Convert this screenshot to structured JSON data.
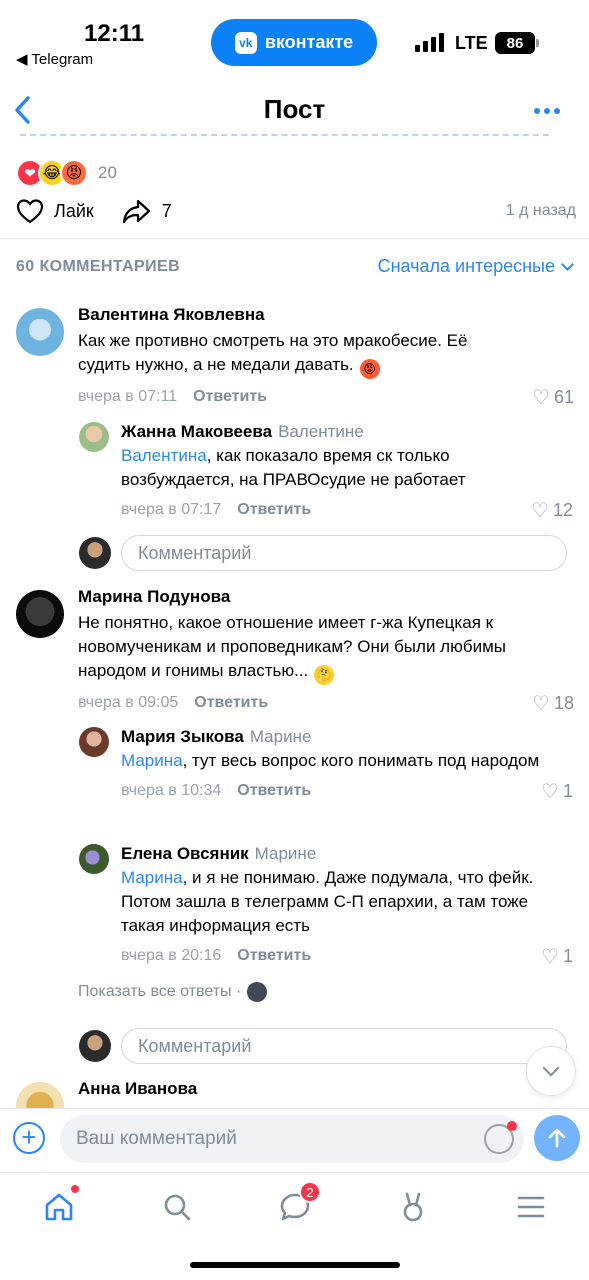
{
  "status_bar": {
    "time": "12:11",
    "back_app": "◀ Telegram",
    "pill_label": "вконтакте",
    "vk_logo": "vk",
    "network": "LTE",
    "battery": "86"
  },
  "nav": {
    "title": "Пост"
  },
  "post": {
    "reactions_count": "20",
    "like_label": "Лайк",
    "share_count": "7",
    "time": "1 д назад"
  },
  "comments_header": {
    "count_label": "60 КОММЕНТАРИЕВ",
    "sort_label": "Сначала интересные"
  },
  "comments": [
    {
      "name": "Валентина Яковлевна",
      "text": "Как же противно смотреть на это мракобесие. Её судить нужно, а не медали давать.",
      "time": "вчера в 07:11",
      "reply": "Ответить",
      "likes": "61",
      "replies": [
        {
          "name": "Жанна Маковеева",
          "to": "Валентине",
          "mention": "Валентина",
          "text": ", как показало время ск только возбуждается, на ПРАВОсудие не работает",
          "time": "вчера в 07:17",
          "reply": "Ответить",
          "likes": "12"
        }
      ]
    },
    {
      "name": "Марина Подунова",
      "text": "Не понятно, какое отношение имеет г-жа Купецкая к новомученикам и проповедникам? Они были любимы народом и гонимы властью...",
      "time": "вчера в 09:05",
      "reply": "Ответить",
      "likes": "18",
      "replies": [
        {
          "name": "Мария Зыкова",
          "to": "Марине",
          "mention": "Марина",
          "text": ", тут весь вопрос кого понимать под народом",
          "time": "вчера в 10:34",
          "reply": "Ответить",
          "likes": "1"
        },
        {
          "name": "Елена Овсяник",
          "to": "Марине",
          "mention": "Марина",
          "text": ",  и я не понимаю. Даже подумала, что фейк. Потом зашла в телеграмм С-П епархии, а там тоже такая информация есть",
          "time": "вчера в 20:16",
          "reply": "Ответить",
          "likes": "1"
        }
      ],
      "show_all": "Показать все ответы ·"
    },
    {
      "name": "Анна Иванова"
    }
  ],
  "comment_input_placeholder": "Комментарий",
  "composer": {
    "placeholder": "Ваш комментарий"
  },
  "tabbar": {
    "messages_badge": "2"
  },
  "colors": {
    "accent": "#2a87f0",
    "secondary_text": "#818c99",
    "badge": "#ff3347"
  }
}
